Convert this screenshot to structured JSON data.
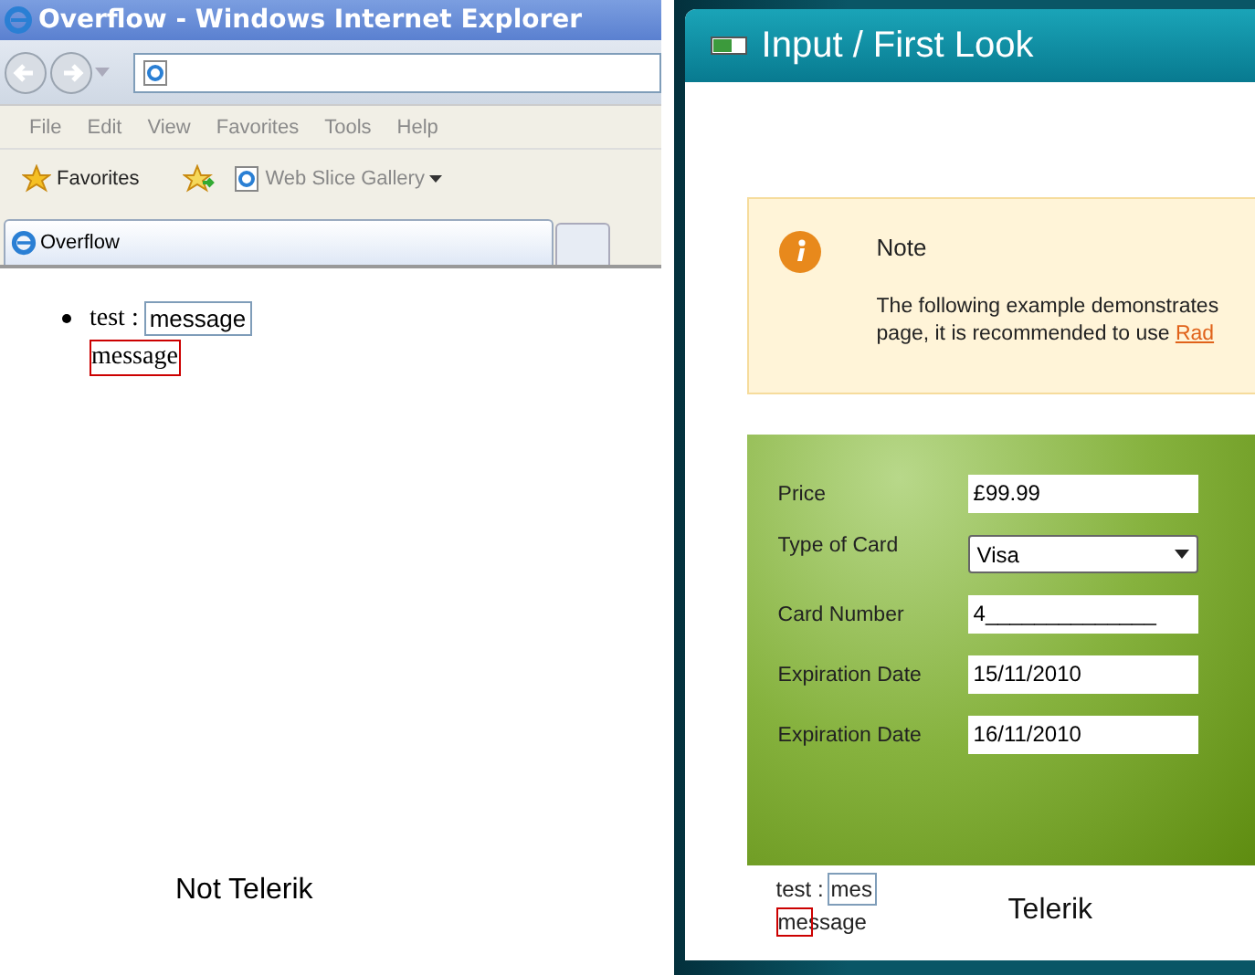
{
  "ie": {
    "window_title": "Overflow - Windows Internet Explorer",
    "menu": [
      "File",
      "Edit",
      "View",
      "Favorites",
      "Tools",
      "Help"
    ],
    "favorites": "Favorites",
    "web_slice": "Web Slice Gallery",
    "tab": "Overflow",
    "item": {
      "label": "test :",
      "input_value": "message",
      "overflow_text": "message"
    },
    "caption": "Not Telerik"
  },
  "telerik": {
    "title": "Input / First Look",
    "note": {
      "heading": "Note",
      "line1": "The following example demonstrates",
      "line2": "page, it is recommended to use ",
      "link": "Rad"
    },
    "form": [
      {
        "label": "Price",
        "value": "£99.99",
        "kind": "text"
      },
      {
        "label": "Type of Card",
        "value": "Visa",
        "kind": "dropdown"
      },
      {
        "label": "Card Number",
        "value": "4______________",
        "kind": "text"
      },
      {
        "label": "Expiration Date",
        "value": "15/11/2010",
        "kind": "text"
      },
      {
        "label": "Expiration Date",
        "value": "16/11/2010",
        "kind": "text"
      }
    ],
    "item": {
      "label": "test :",
      "input_value": "mes",
      "overflow_text": "message"
    },
    "caption": "Telerik"
  }
}
